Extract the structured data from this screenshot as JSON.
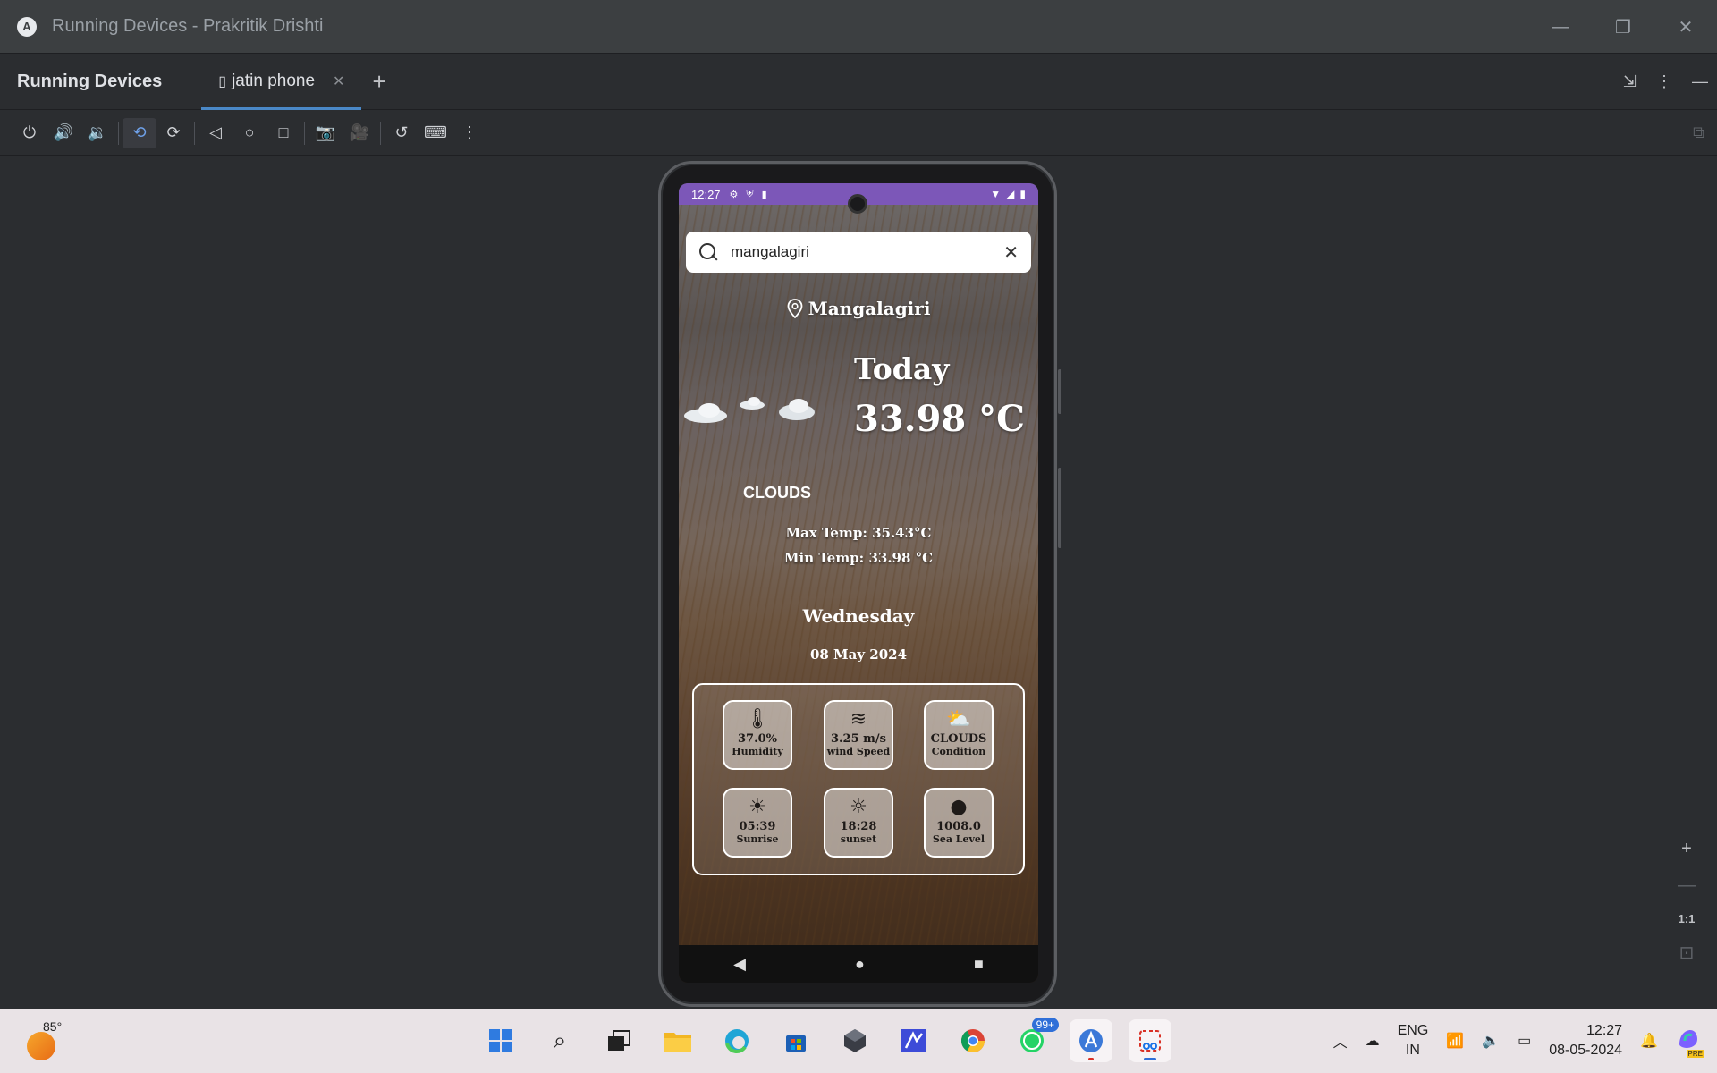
{
  "window": {
    "title": "Running Devices - Prakritik Drishti",
    "minimize": "—",
    "restore": "❐",
    "close": "✕"
  },
  "tabbar": {
    "tool_title": "Running Devices",
    "tab_label": "jatin phone",
    "tab_close": "✕",
    "add": "+"
  },
  "toolbar": {
    "icons": [
      "power-icon",
      "volume-up-icon",
      "volume-down-icon",
      "rotate-left-icon",
      "rotate-right-icon",
      "back-icon",
      "home-icon",
      "overview-icon",
      "screenshot-icon",
      "screen-record-icon",
      "snapshot-icon",
      "keyboard-icon",
      "more-icon"
    ]
  },
  "phone": {
    "status_time": "12:27",
    "search": {
      "value": "mangalagiri",
      "clear": "✕"
    },
    "location": "Mangalagiri",
    "today_label": "Today",
    "temperature": "33.98 °C",
    "condition": "CLOUDS",
    "max_temp": "Max Temp: 35.43°C",
    "min_temp": "Min Temp: 33.98 °C",
    "day": "Wednesday",
    "date": "08 May 2024",
    "tiles": [
      {
        "icon": "thermometer-icon",
        "glyph": "🌡",
        "value": "37.0%",
        "label": "Humidity"
      },
      {
        "icon": "wind-icon",
        "glyph": "≋",
        "value": "3.25 m/s",
        "label": "wind Speed"
      },
      {
        "icon": "cloud-sun-icon",
        "glyph": "⛅",
        "value": "CLOUDS",
        "label": "Condition"
      },
      {
        "icon": "sunrise-icon",
        "glyph": "☀",
        "value": "05:39",
        "label": "Sunrise"
      },
      {
        "icon": "sunset-icon",
        "glyph": "☼",
        "value": "18:28",
        "label": "sunset"
      },
      {
        "icon": "sea-level-icon",
        "glyph": "●",
        "value": "1008.0",
        "label": "Sea Level"
      }
    ],
    "nav": {
      "back": "◀",
      "home": "●",
      "recents": "■"
    }
  },
  "zoom": {
    "in": "+",
    "out": "—",
    "one_to_one": "1:1",
    "fit": "⊡"
  },
  "taskbar": {
    "weather_temp": "85°",
    "badge_whatsapp": "99+",
    "lang_top": "ENG",
    "lang_bottom": "IN",
    "time": "12:27",
    "date": "08-05-2024",
    "pre_badge": "PRE"
  },
  "colors": {
    "accent": "#4a88c7",
    "statusbar": "#7c57b8",
    "taskbar": "#e9e3e6"
  }
}
